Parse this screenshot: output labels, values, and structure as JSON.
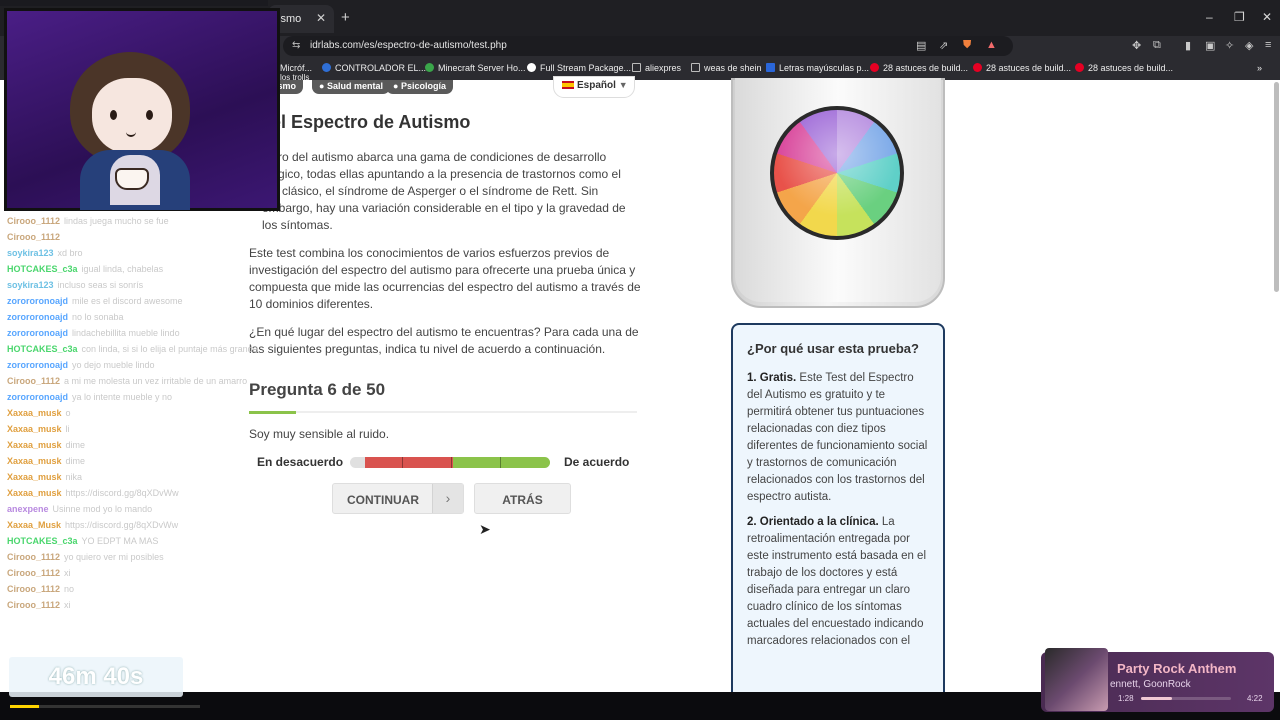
{
  "browser": {
    "tab_title": "ismo",
    "tab_close": "✕",
    "new_tab": "+",
    "url": "idrlabs.com/es/espectro-de-autismo/test.php",
    "bookmarks": [
      {
        "label": "Micróf...",
        "color": "#7a7a7a"
      },
      {
        "label": "CONTROLADOR EL...",
        "color": "#2f6fd6"
      },
      {
        "label": "Minecraft Server Ho...",
        "color": "#3aa64a"
      },
      {
        "label": "Full Stream Package...",
        "color": "#ffffff"
      },
      {
        "label": "aliexpres",
        "color": "#b0b0b0"
      },
      {
        "label": "weas de shein",
        "color": "#b0b0b0"
      },
      {
        "label": "Letras mayúsculas p...",
        "color": "#2a66d9"
      },
      {
        "label": "28 astuces de build...",
        "color": "#e60023"
      },
      {
        "label": "28 astuces de build...",
        "color": "#e60023"
      },
      {
        "label": "28 astuces de build...",
        "color": "#e60023"
      }
    ],
    "bookmark_sub": "los trolls"
  },
  "page": {
    "tags": [
      "ismo",
      "Salud mental",
      "Psicología"
    ],
    "language": "Español",
    "title": "t del Espectro de Autismo",
    "intro_1": "ectro del autismo abarca una gama de condiciones de desarrollo ológico, todas ellas apuntando a la presencia de trastornos como el mo clásico, el síndrome de Asperger o el síndrome de Rett. Sin embargo, hay una variación considerable en el tipo y la gravedad de los síntomas.",
    "intro_2": "Este test combina los conocimientos de varios esfuerzos previos de investigación del espectro del autismo para ofrecerte una prueba única y compuesta que mide las ocurrencias del espectro del autismo a través de 10 dominios diferentes.",
    "intro_3": "¿En qué lugar del espectro del autismo te encuentras? Para cada una de las siguientes preguntas, indica tu nivel de acuerdo a continuación.",
    "question_header": "Pregunta 6 de 50",
    "question_progress": 0.12,
    "question_text": "Soy muy sensible al ruido.",
    "scale_left": "En desacuerdo",
    "scale_right": "De acuerdo",
    "btn_continue": "CONTINUAR",
    "btn_back": "ATRÁS",
    "why_title": "¿Por qué usar esta prueba?",
    "why_1_bold": "1. Gratis.",
    "why_1_text": " Este Test del Espectro del Autismo es gratuito y te permitirá obtener tus puntuaciones relacionadas con diez tipos diferentes de funcionamiento social y trastornos de comunicación relacionados con los trastornos del espectro autista.",
    "why_2_bold": "2. Orientado a la clínica.",
    "why_2_text": " La retroalimentación entregada por este instrumento está basada en el trabajo de los doctores y está diseñada para entregar un claro cuadro clínico de los síntomas actuales del encuestado indicando marcadores relacionados con el"
  },
  "stream": {
    "chat": [
      {
        "user": "Cirooo_1112",
        "msg": "lindas juega mucho se fue",
        "color": "#c9a77c"
      },
      {
        "user": "Cirooo_1112",
        "msg": "",
        "color": "#c9a77c"
      },
      {
        "user": "soykira123",
        "msg": "xd bro",
        "color": "#6ec1e4"
      },
      {
        "user": "HOTCAKES_c3a",
        "msg": "igual linda, chabelas",
        "color": "#4ad66d"
      },
      {
        "user": "soykira123",
        "msg": "incluso seas si sonrís",
        "color": "#6ec1e4"
      },
      {
        "user": "zorororonoajd",
        "msg": "mile es el discord awesome",
        "color": "#58a6ff"
      },
      {
        "user": "zorororonoajd",
        "msg": "no lo sonaba",
        "color": "#58a6ff"
      },
      {
        "user": "zorororonoajd",
        "msg": "lindachebillita mueble lindo",
        "color": "#58a6ff"
      },
      {
        "user": "HOTCAKES_c3a",
        "msg": "con linda, si si lo elija el puntaje más grande",
        "color": "#4ad66d"
      },
      {
        "user": "zorororonoajd",
        "msg": "yo dejo mueble lindo",
        "color": "#58a6ff"
      },
      {
        "user": "Cirooo_1112",
        "msg": "a mi me molesta un vez irritable de un amarro",
        "color": "#c9a77c"
      },
      {
        "user": "zorororonoajd",
        "msg": "ya lo intente mueble y no",
        "color": "#58a6ff"
      },
      {
        "user": "Xaxaa_musk",
        "msg": "o",
        "color": "#e0a040"
      },
      {
        "user": "Xaxaa_musk",
        "msg": "li",
        "color": "#e0a040"
      },
      {
        "user": "Xaxaa_musk",
        "msg": "dime",
        "color": "#e0a040"
      },
      {
        "user": "Xaxaa_musk",
        "msg": "dime",
        "color": "#e0a040"
      },
      {
        "user": "Xaxaa_musk",
        "msg": "nika",
        "color": "#e0a040"
      },
      {
        "user": "Xaxaa_musk",
        "msg": "https://discord.gg/8qXDvWw",
        "color": "#e0a040"
      },
      {
        "user": "anexpene",
        "msg": "Usinne mod yo lo mando",
        "color": "#b98ae0"
      },
      {
        "user": "Xaxaa_Musk",
        "msg": "https://discord.gg/8qXDvWw",
        "color": "#e0a040"
      },
      {
        "user": "HOTCAKES_c3a",
        "msg": "YO EDPT MA MAS",
        "color": "#4ad66d"
      },
      {
        "user": "Cirooo_1112",
        "msg": "yo quiero ver mi posibles",
        "color": "#c9a77c"
      },
      {
        "user": "Cirooo_1112",
        "msg": "xi",
        "color": "#c9a77c"
      },
      {
        "user": "Cirooo_1112",
        "msg": "no",
        "color": "#c9a77c"
      },
      {
        "user": "Cirooo_1112",
        "msg": "xi",
        "color": "#c9a77c"
      }
    ],
    "timer": "46m 40s",
    "timer_progress": 0.15,
    "song_title": "Party Rock Anthem",
    "song_artist": "ennett, GoonRock",
    "song_elapsed": "1:28",
    "song_total": "4:22",
    "song_progress": 0.34
  }
}
